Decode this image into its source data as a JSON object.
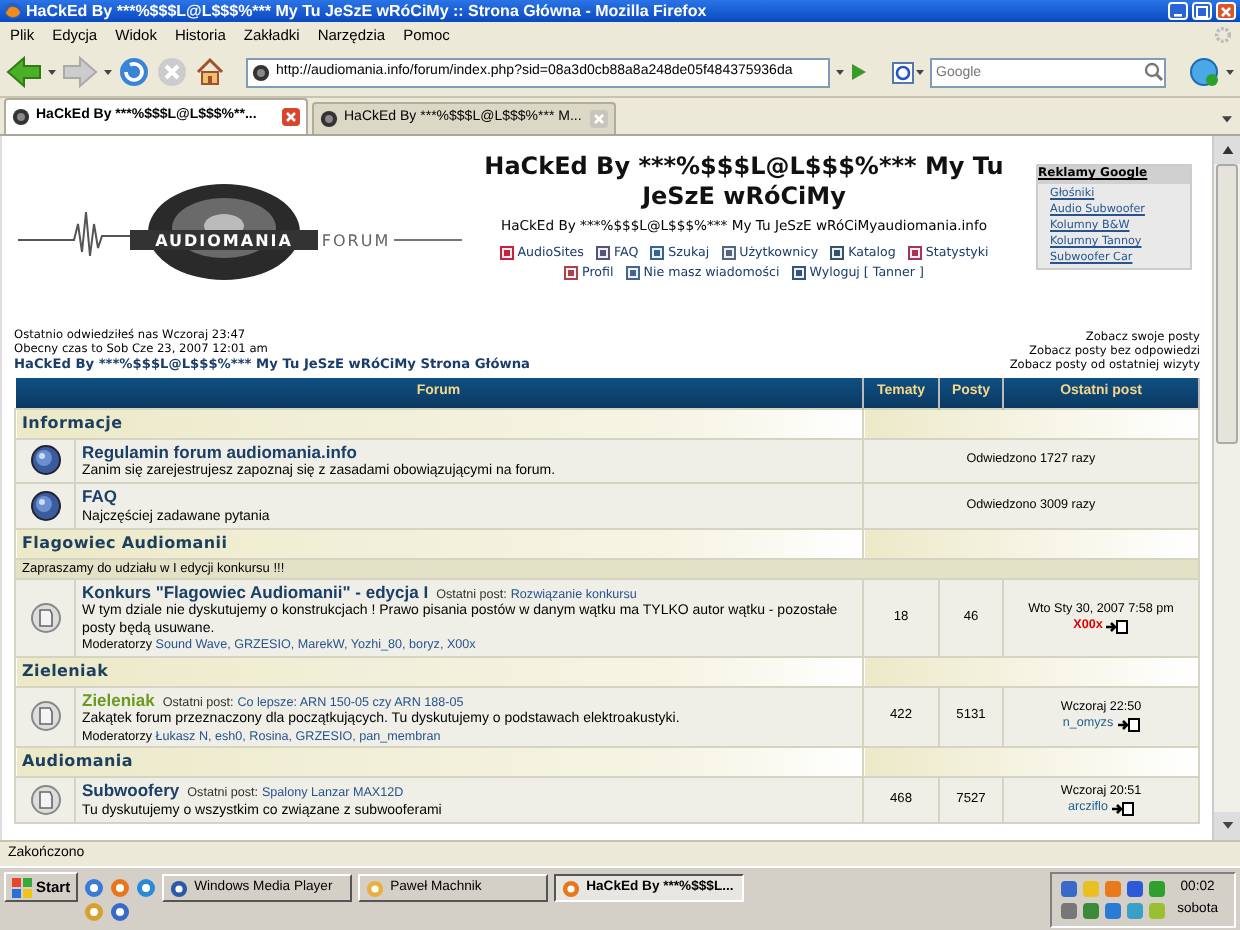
{
  "window": {
    "title": "HaCkEd By ***%$$$L@L$$$%*** My Tu JeSzE wRóCiMy :: Strona Główna - Mozilla Firefox"
  },
  "menu": [
    "Plik",
    "Edycja",
    "Widok",
    "Historia",
    "Zakładki",
    "Narzędzia",
    "Pomoc"
  ],
  "toolbar": {
    "url": "http://audiomania.info/forum/index.php?sid=08a3d0cb88a8a248de05f484375936da",
    "search_placeholder": "Google"
  },
  "tabs": [
    {
      "label": "HaCkEd By ***%$$$L@L$$$%**...",
      "selected": true
    },
    {
      "label": "HaCkEd By ***%$$$L@L$$$%*** M...",
      "selected": false
    }
  ],
  "header": {
    "logo": {
      "brand": "AUDIOMANIA",
      "suffix": "FORUM"
    },
    "title": "HaCkEd By ***%$$$L@L$$$%*** My Tu JeSzE wRóCiMy",
    "subtitle": "HaCkEd By ***%$$$L@L$$$%*** My Tu JeSzE wRóCiMyaudiomania.info",
    "nav_rows": [
      {
        "links": [
          "AudioSites",
          "FAQ",
          "Szukaj",
          "Użytkownicy",
          "Katalog",
          "Statystyki"
        ]
      },
      {
        "links": [
          "Profil",
          "Nie masz wiadomości",
          "Wyloguj [ Tanner ]"
        ]
      }
    ],
    "ads": {
      "title": "Reklamy Google",
      "links": [
        "Głośniki",
        "Audio Subwoofer",
        "Kolumny B&W",
        "Kolumny Tannoy",
        "Subwoofer Car"
      ]
    }
  },
  "info": {
    "last_visit": "Ostatnio odwiedziłeś nas Wczoraj 23:47",
    "current_time": "Obecny czas to Sob Cze 23, 2007 12:01 am",
    "breadcrumb": "HaCkEd By ***%$$$L@L$$$%*** My Tu JeSzE wRóCiMy Strona Główna",
    "links": [
      "Zobacz swoje posty",
      "Zobacz posty bez odpowiedzi",
      "Zobacz posty od ostatniej wizyty"
    ]
  },
  "table": {
    "columns": [
      "Forum",
      "Tematy",
      "Posty",
      "Ostatni post"
    ],
    "sections": [
      {
        "title": "Informacje",
        "forums": [
          {
            "kind": "link",
            "title": "Regulamin forum audiomania.info",
            "color": "#1b3f66",
            "description": "Zanim się zarejestrujesz zapoznaj się z zasadami obowiązującymi na forum.",
            "visits": "Odwiedzono 1727 razy"
          },
          {
            "kind": "link",
            "title": "FAQ",
            "color": "#1b3f66",
            "description": "Najczęściej zadawane pytania",
            "visits": "Odwiedzono 3009 razy"
          }
        ]
      },
      {
        "title": "Flagowiec Audiomanii",
        "description": "Zapraszamy do udziału w I edycji konkursu !!!",
        "forums": [
          {
            "kind": "forum",
            "title": "Konkurs \"Flagowiec Audiomanii\" - edycja I",
            "color": "#1b3f66",
            "last_post_label": "Ostatni post:",
            "last_post_title": "Rozwiązanie konkursu",
            "description": "W tym dziale nie dyskutujemy o konstrukcjach ! Prawo pisania postów w danym wątku ma TYLKO autor wątku - pozostałe posty będą usuwane.",
            "moderators_label": "Moderatorzy",
            "moderators": "Sound Wave, GRZESIO, MarekW, Yozhi_80, boryz, X00x",
            "topics": "18",
            "posts": "46",
            "last_post": {
              "time": "Wto Sty 30, 2007 7:58 pm",
              "user": "X00x",
              "color": "#dd0000"
            }
          }
        ]
      },
      {
        "title": "Zieleniak",
        "forums": [
          {
            "kind": "forum",
            "title": "Zieleniak",
            "color": "#6c9a1e",
            "last_post_label": "Ostatni post:",
            "last_post_title": "Co lepsze: ARN 150-05 czy ARN 188-05",
            "description": "Zakątek forum przeznaczony dla początkujących. Tu dyskutujemy o podstawach elektroakustyki.",
            "moderators_label": "Moderatorzy",
            "moderators": "Łukasz N, esh0, Rosina, GRZESIO, pan_membran",
            "topics": "422",
            "posts": "5131",
            "last_post": {
              "time": "Wczoraj 22:50",
              "user": "n_omyzs",
              "color": "#1f5f8f"
            }
          }
        ]
      },
      {
        "title": "Audiomania",
        "forums": [
          {
            "kind": "forum",
            "title": "Subwoofery",
            "color": "#1b3f66",
            "last_post_label": "Ostatni post:",
            "last_post_title": "Spalony Lanzar MAX12D",
            "description": "Tu dyskutujemy o wszystkim co związane z subwooferami",
            "topics": "468",
            "posts": "7527",
            "last_post": {
              "time": "Wczoraj 20:51",
              "user": "arcziflo",
              "color": "#1f5f8f"
            }
          }
        ]
      }
    ]
  },
  "status_bar": "Zakończono",
  "taskbar": {
    "start": "Start",
    "tasks": [
      {
        "label": "Windows Media Player",
        "selected": false
      },
      {
        "label": "Paweł Machnik",
        "selected": false
      },
      {
        "label": "HaCkEd By ***%$$$L...",
        "selected": true
      }
    ],
    "clock": {
      "time": "00:02",
      "day": "sobota"
    }
  }
}
